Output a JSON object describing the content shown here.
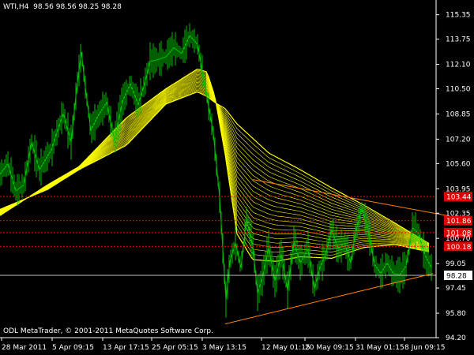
{
  "header": {
    "symbol_timeframe": "WTI,H4",
    "open": "98.56",
    "high": "98.56",
    "low": "98.25",
    "close": "98.28"
  },
  "footer": "ODL MetaTrader, © 2001-2011 MetaQuotes Software Corp.",
  "colors": {
    "background": "#000000",
    "price_line": "#00c000",
    "ribbon": "#ffff00",
    "trendline": "#ff8000",
    "levels": "#ff0000",
    "current_price_line": "#c0c0c0",
    "text": "#ffffff"
  },
  "chart_data": {
    "type": "line",
    "title": "WTI,H4",
    "xlabel": "",
    "ylabel": "",
    "ylim": [
      94.2,
      115.9
    ],
    "grid": false,
    "x_tick_labels": [
      "28 Mar 2011",
      "5 Apr 09:15",
      "13 Apr 17:15",
      "25 Apr 05:15",
      "3 May 13:15",
      "12 May 01:15",
      "20 May 09:15",
      "31 May 01:15",
      "8 Jun 09:15"
    ],
    "y_tick_labels": [
      "115.35",
      "113.75",
      "112.10",
      "110.50",
      "108.85",
      "107.20",
      "105.60",
      "103.95",
      "102.35",
      "100.70",
      "99.05",
      "97.45",
      "95.80",
      "94.20"
    ],
    "series": [
      {
        "role": "price",
        "points": [
          [
            0,
            104.9
          ],
          [
            10,
            105.6
          ],
          [
            20,
            103.8
          ],
          [
            30,
            104.2
          ],
          [
            40,
            107.0
          ],
          [
            50,
            105.2
          ],
          [
            65,
            106.5
          ],
          [
            80,
            108.9
          ],
          [
            90,
            107.0
          ],
          [
            97,
            110.5
          ],
          [
            103,
            112.9
          ],
          [
            108,
            110.6
          ],
          [
            115,
            107.8
          ],
          [
            125,
            108.8
          ],
          [
            135,
            109.6
          ],
          [
            145,
            107.1
          ],
          [
            155,
            109.7
          ],
          [
            165,
            110.8
          ],
          [
            175,
            109.5
          ],
          [
            183,
            110.8
          ],
          [
            190,
            112.3
          ],
          [
            200,
            112.4
          ],
          [
            210,
            112.6
          ],
          [
            220,
            113.2
          ],
          [
            230,
            112.8
          ],
          [
            240,
            114.0
          ],
          [
            250,
            113.4
          ],
          [
            260,
            110.5
          ],
          [
            270,
            107.6
          ],
          [
            278,
            103.4
          ],
          [
            286,
            96.7
          ],
          [
            291,
            99.2
          ],
          [
            298,
            100.4
          ],
          [
            305,
            98.8
          ],
          [
            312,
            102.0
          ],
          [
            320,
            100.2
          ],
          [
            326,
            97.1
          ],
          [
            332,
            98.1
          ],
          [
            340,
            100.1
          ],
          [
            348,
            97.9
          ],
          [
            356,
            99.7
          ],
          [
            364,
            97.3
          ],
          [
            372,
            100.5
          ],
          [
            380,
            99.1
          ],
          [
            390,
            100.0
          ],
          [
            398,
            97.4
          ],
          [
            405,
            98.8
          ],
          [
            412,
            99.6
          ],
          [
            420,
            101.3
          ],
          [
            428,
            100.0
          ],
          [
            436,
            100.4
          ],
          [
            444,
            99.1
          ],
          [
            450,
            101.1
          ],
          [
            458,
            102.7
          ],
          [
            466,
            101.3
          ],
          [
            474,
            99.0
          ],
          [
            482,
            98.4
          ],
          [
            490,
            99.1
          ],
          [
            498,
            98.4
          ],
          [
            506,
            98.3
          ],
          [
            514,
            98.9
          ],
          [
            522,
            101.4
          ],
          [
            530,
            101.0
          ],
          [
            538,
            99.6
          ],
          [
            546,
            98.8
          ]
        ]
      }
    ],
    "ribbon_bundle": {
      "description_hidden": true,
      "fast": [
        [
          0,
          102.2
        ],
        [
          60,
          104.2
        ],
        [
          100,
          105.4
        ],
        [
          160,
          108.6
        ],
        [
          210,
          110.5
        ],
        [
          250,
          111.8
        ],
        [
          262,
          111.6
        ],
        [
          272,
          110.0
        ],
        [
          285,
          106.2
        ],
        [
          300,
          101.0
        ],
        [
          320,
          99.3
        ],
        [
          350,
          99.2
        ],
        [
          380,
          99.5
        ],
        [
          420,
          99.4
        ],
        [
          460,
          100.1
        ],
        [
          500,
          100.3
        ],
        [
          545,
          99.8
        ]
      ],
      "slow": [
        [
          0,
          102.6
        ],
        [
          60,
          103.9
        ],
        [
          100,
          105.2
        ],
        [
          160,
          106.8
        ],
        [
          210,
          109.5
        ],
        [
          250,
          110.3
        ],
        [
          262,
          110.0
        ],
        [
          272,
          109.6
        ],
        [
          285,
          109.2
        ],
        [
          300,
          108.2
        ],
        [
          340,
          106.3
        ],
        [
          380,
          105.2
        ],
        [
          420,
          104.0
        ],
        [
          460,
          102.9
        ],
        [
          500,
          101.7
        ],
        [
          545,
          100.3
        ]
      ],
      "count": 24
    },
    "trendlines": [
      {
        "x1": 285,
        "y1": 95.1,
        "x2": 548,
        "y2": 98.4
      },
      {
        "x1": 320,
        "y1": 104.55,
        "x2": 565,
        "y2": 102.2
      }
    ],
    "horizontal_levels": [
      {
        "value": 103.44,
        "label": "103.44",
        "style": "dotted"
      },
      {
        "value": 101.86,
        "label": "101.86",
        "style": "dotted"
      },
      {
        "value": 101.08,
        "label": "101.08",
        "style": "dotted"
      },
      {
        "value": 100.18,
        "label": "100.18",
        "style": "dotted"
      },
      {
        "value": 98.28,
        "label": "98.28",
        "style": "solid"
      }
    ]
  }
}
